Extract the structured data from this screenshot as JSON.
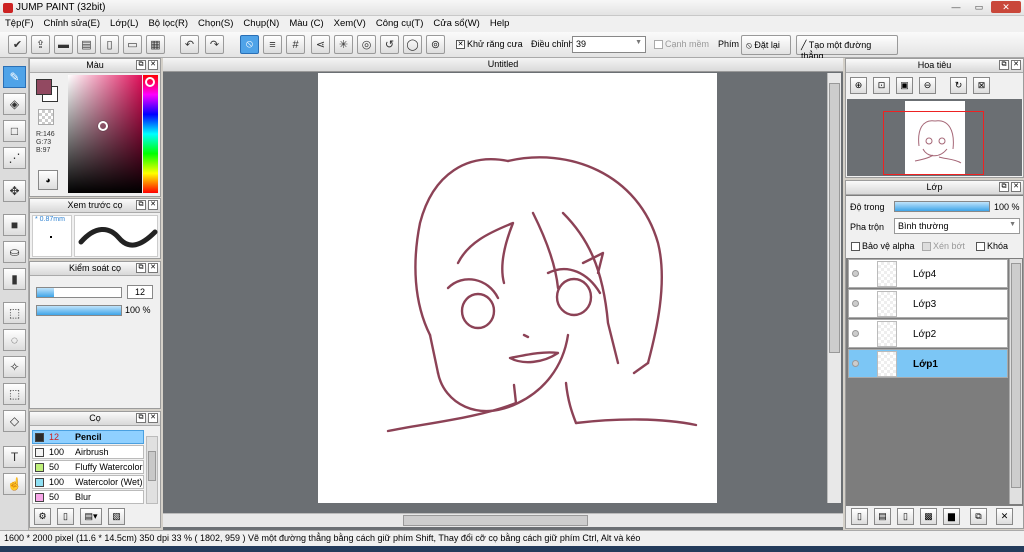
{
  "window": {
    "title": "JUMP PAINT (32bit)",
    "min": "—",
    "max": "▭",
    "close": "✕"
  },
  "menu": [
    "Tệp(F)",
    "Chỉnh sửa(E)",
    "Lớp(L)",
    "Bộ lọc(R)",
    "Chọn(S)",
    "Chụp(N)",
    "Màu (C)",
    "Xem(V)",
    "Công cụ(T)",
    "Cửa sổ(W)",
    "Help"
  ],
  "toolbar": {
    "antialias_label": "Khử răng cưa",
    "adjust_label": "Điều chỉnh",
    "adjust_value": "39",
    "smooth_label": "Cạnh mềm",
    "key_label": "Phím",
    "reset_label": "Đặt lại",
    "line_label": "Tạo một đường thẳng"
  },
  "color_panel": {
    "title": "Màu",
    "r": "R:146",
    "g": "G:73",
    "b": "B:97",
    "fg_color": "#924961"
  },
  "brush_preview": {
    "title": "Xem trước cọ",
    "size": "0.87mm"
  },
  "brush_control": {
    "title": "Kiểm soát cọ",
    "size_value": "12",
    "size_fraction": 0.2,
    "opacity_value": "100 %",
    "opacity_fraction": 1.0
  },
  "brushes": {
    "title": "Cọ",
    "items": [
      {
        "size": "12",
        "name": "Pencil",
        "color": "#2a2a2a",
        "selected": true
      },
      {
        "size": "100",
        "name": "Airbrush",
        "color": "#f4f4f4",
        "selected": false
      },
      {
        "size": "50",
        "name": "Fluffy Watercolor",
        "color": "#bff07a",
        "selected": false
      },
      {
        "size": "100",
        "name": "Watercolor (Wet)",
        "color": "#8fe0f4",
        "selected": false
      },
      {
        "size": "50",
        "name": "Blur",
        "color": "#f7a6e8",
        "selected": false
      }
    ]
  },
  "document": {
    "tab": "Untitled"
  },
  "navigator": {
    "title": "Hoa tiêu"
  },
  "layers": {
    "title": "Lớp",
    "opacity_label": "Độ trong",
    "opacity_value": "100 %",
    "opacity_fraction": 1.0,
    "blend_label": "Pha trộn",
    "blend_value": "Bình thường",
    "protect_alpha": "Bảo vệ alpha",
    "clip": "Xén bớt",
    "lock": "Khóa",
    "items": [
      {
        "name": "Lớp4",
        "selected": false
      },
      {
        "name": "Lớp3",
        "selected": false
      },
      {
        "name": "Lớp2",
        "selected": false
      },
      {
        "name": "Lớp1",
        "selected": true
      }
    ]
  },
  "status": {
    "text": "1600 * 2000 pixel   (11.6 * 14.5cm)   350 dpi   33 %   ( 1802, 959 )   Vẽ một đường thẳng bằng cách giữ phím Shift, Thay đổi cỡ cọ bằng cách giữ phím Ctrl, Alt và kéo"
  }
}
